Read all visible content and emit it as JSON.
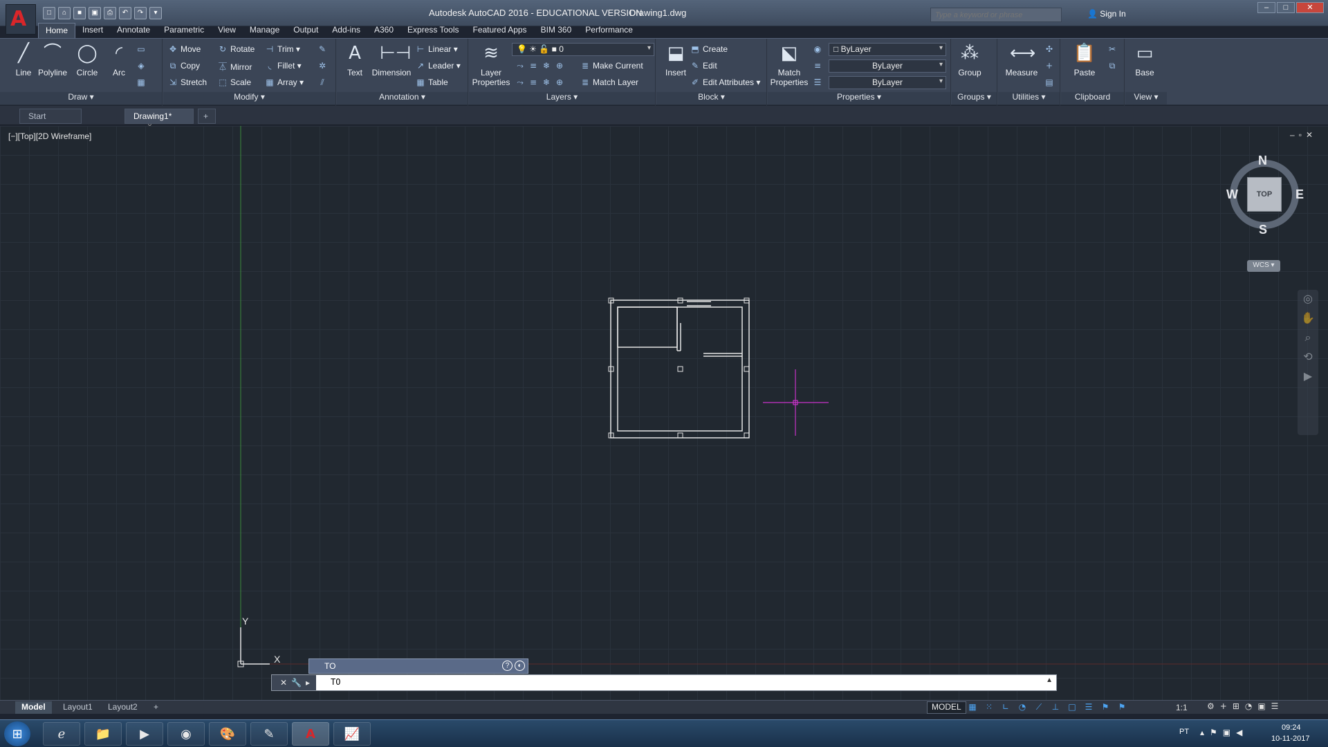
{
  "window": {
    "title": "Autodesk AutoCAD 2016 - EDUCATIONAL VERSION",
    "file": "Drawing1.dwg"
  },
  "search": {
    "placeholder": "Type a keyword or phrase"
  },
  "header": {
    "sign_in": "Sign In"
  },
  "ribbon_tabs": [
    "Home",
    "Insert",
    "Annotate",
    "Parametric",
    "View",
    "Manage",
    "Output",
    "Add-ins",
    "A360",
    "Express Tools",
    "Featured Apps",
    "BIM 360",
    "Performance"
  ],
  "panels": {
    "draw": {
      "title": "Draw",
      "line": "Line",
      "polyline": "Polyline",
      "circle": "Circle",
      "arc": "Arc"
    },
    "modify": {
      "title": "Modify",
      "move": "Move",
      "rotate": "Rotate",
      "trim": "Trim",
      "copy": "Copy",
      "mirror": "Mirror",
      "fillet": "Fillet",
      "stretch": "Stretch",
      "scale": "Scale",
      "array": "Array"
    },
    "annotation": {
      "title": "Annotation",
      "text": "Text",
      "dimension": "Dimension",
      "linear": "Linear",
      "leader": "Leader",
      "table": "Table"
    },
    "layers": {
      "title": "Layers",
      "layer_properties_1": "Layer",
      "layer_properties_2": "Properties",
      "current_layer": "0",
      "make_current": "Make Current",
      "match_layer": "Match Layer"
    },
    "block": {
      "title": "Block",
      "insert": "Insert",
      "create": "Create",
      "edit": "Edit",
      "edit_attributes": "Edit Attributes"
    },
    "properties": {
      "title": "Properties",
      "match_1": "Match",
      "match_2": "Properties",
      "color": "ByLayer",
      "linetype": "ByLayer",
      "lineweight": "ByLayer"
    },
    "groups": {
      "title": "Groups",
      "group": "Group"
    },
    "utilities": {
      "title": "Utilities",
      "measure": "Measure"
    },
    "clipboard": {
      "title": "Clipboard",
      "paste": "Paste"
    },
    "view": {
      "title": "View",
      "base": "Base"
    }
  },
  "doc_tabs": {
    "start": "Start",
    "drawing": "Drawing1*"
  },
  "viewport": {
    "label": "[−][Top][2D Wireframe]"
  },
  "viewcube": {
    "n": "N",
    "s": "S",
    "e": "E",
    "w": "W",
    "top": "TOP",
    "wcs": "WCS"
  },
  "ucs": {
    "x": "X",
    "y": "Y"
  },
  "command": {
    "tooltip": "TO",
    "input": "TO"
  },
  "layout_tabs": {
    "model": "Model",
    "layout1": "Layout1",
    "layout2": "Layout2"
  },
  "status": {
    "model": "MODEL",
    "scale": "1:1"
  },
  "taskbar": {
    "lang": "PT",
    "time": "09:24",
    "date": "10-11-2017"
  },
  "colors": {
    "accent": "#d9262a",
    "crosshair": "#c832c8",
    "ucs_y_axis": "#3c8a3c"
  }
}
